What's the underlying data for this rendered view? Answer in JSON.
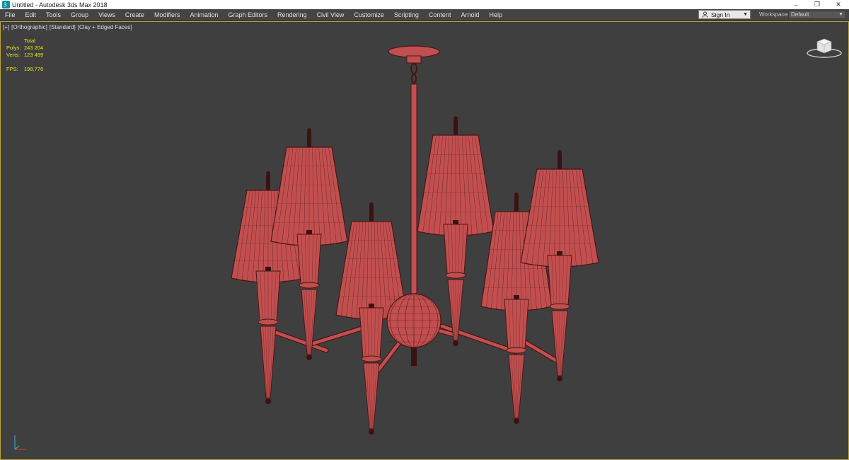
{
  "window": {
    "title": "Untitled - Autodesk 3ds Max 2018",
    "controls": {
      "minimize": "–",
      "restore": "❐",
      "close": "✕"
    }
  },
  "menu": {
    "items": [
      "File",
      "Edit",
      "Tools",
      "Group",
      "Views",
      "Create",
      "Modifiers",
      "Animation",
      "Graph Editors",
      "Rendering",
      "Civil View",
      "Customize",
      "Scripting",
      "Content",
      "Arnold",
      "Help"
    ]
  },
  "account": {
    "signin_label": "Sign In"
  },
  "workspaces": {
    "label": "Workspaces:",
    "value": "Default"
  },
  "viewport": {
    "label_parts": [
      "[+]",
      "[Orthographic]",
      "[Standard]",
      "[Clay + Edged Faces]"
    ],
    "stats": {
      "header": "Total",
      "polys_label": "Polys:",
      "polys_value": "243 204",
      "verts_label": "Verts:",
      "verts_value": "123 499",
      "fps_label": "FPS:",
      "fps_value": "198,776"
    }
  },
  "colors": {
    "viewport_bg": "#3f3f3f",
    "active_border": "#b9a23a",
    "stats_text": "#e6e21c",
    "model_fill": "#c24f4f",
    "wire": "#4a1616"
  },
  "icons": {
    "app": "3dsmax-logo-icon",
    "user": "user-icon",
    "viewcube": "viewcube-icon",
    "axis": "axis-tripod-icon"
  }
}
